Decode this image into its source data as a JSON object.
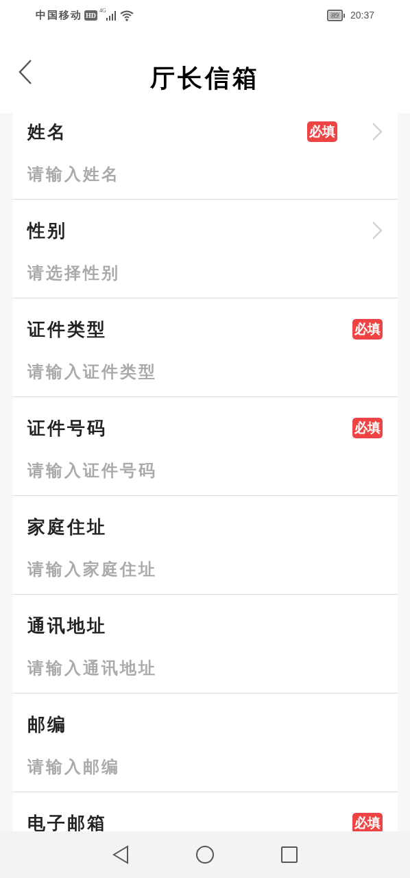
{
  "status_bar": {
    "carrier": "中国移动",
    "hd": "HD",
    "network": "4G",
    "battery": "89",
    "time": "20:37"
  },
  "header": {
    "title": "厅长信箱"
  },
  "fields": [
    {
      "label": "姓名",
      "placeholder": "请输入姓名",
      "required": true,
      "kind": "select",
      "required_badge": "必填"
    },
    {
      "label": "性别",
      "placeholder": "请选择性别",
      "required": false,
      "kind": "select"
    },
    {
      "label": "证件类型",
      "placeholder": "请输入证件类型",
      "required": true,
      "kind": "input",
      "required_badge": "必填"
    },
    {
      "label": "证件号码",
      "placeholder": "请输入证件号码",
      "required": true,
      "kind": "input",
      "required_badge": "必填"
    },
    {
      "label": "家庭住址",
      "placeholder": "请输入家庭住址",
      "required": false,
      "kind": "input"
    },
    {
      "label": "通讯地址",
      "placeholder": "请输入通讯地址",
      "required": false,
      "kind": "input"
    },
    {
      "label": "邮编",
      "placeholder": "请输入邮编",
      "required": false,
      "kind": "input"
    },
    {
      "label": "电子邮箱",
      "required": true,
      "kind": "input",
      "required_badge": "必填"
    }
  ]
}
